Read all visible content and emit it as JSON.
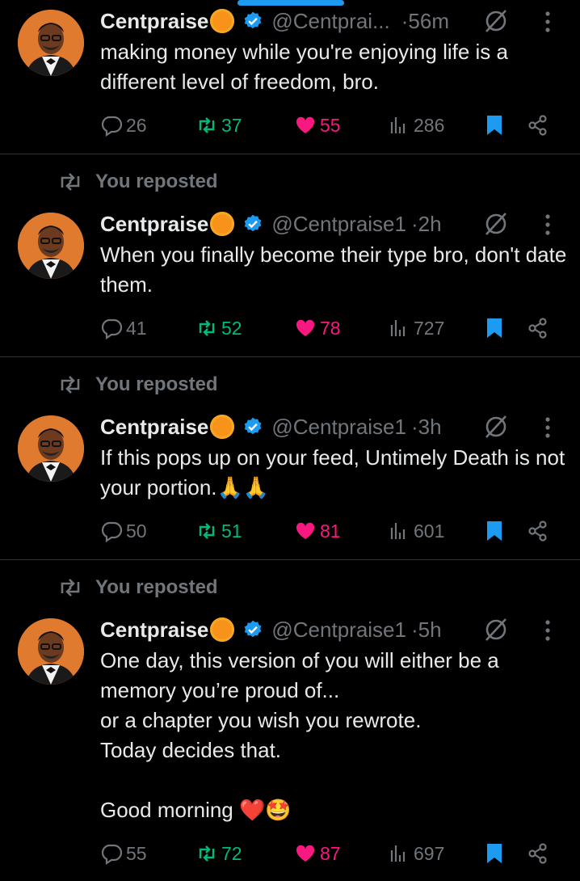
{
  "colors": {
    "background": "#000000",
    "text": "#e7e9ea",
    "muted": "#71767b",
    "retweet": "#00ba7c",
    "like": "#f91880",
    "accent": "#1d9bf0"
  },
  "posts": [
    {
      "reposted_label": "",
      "name": "Centpraise",
      "handle": "@Centprai...",
      "time": "·56m",
      "text": "making money while you're enjoying life is a different level of freedom, bro.",
      "replies": "26",
      "reposts": "37",
      "likes": "55",
      "views": "286"
    },
    {
      "reposted_label": "You reposted",
      "name": "Centpraise",
      "handle": "@Centpraise1",
      "time": "·2h",
      "text": "When you finally become their type bro, don't date them.",
      "replies": "41",
      "reposts": "52",
      "likes": "78",
      "views": "727"
    },
    {
      "reposted_label": "You reposted",
      "name": "Centpraise",
      "handle": "@Centpraise1",
      "time": "·3h",
      "text": "If this pops up on your feed, Untimely Death is not your portion.🙏🙏",
      "replies": "50",
      "reposts": "51",
      "likes": "81",
      "views": "601"
    },
    {
      "reposted_label": "You reposted",
      "name": "Centpraise",
      "handle": "@Centpraise1",
      "time": "·5h",
      "text": "One day, this version of you will either be a memory you’re proud of...\nor a chapter you wish you rewrote.\nToday decides that.\n\nGood morning ❤️🤩",
      "replies": "55",
      "reposts": "72",
      "likes": "87",
      "views": "697"
    }
  ],
  "icons": [
    "reply-icon",
    "repost-icon",
    "heart-icon",
    "views-icon",
    "bookmark-icon",
    "share-icon",
    "grok-icon",
    "more-icon",
    "verified-icon"
  ]
}
